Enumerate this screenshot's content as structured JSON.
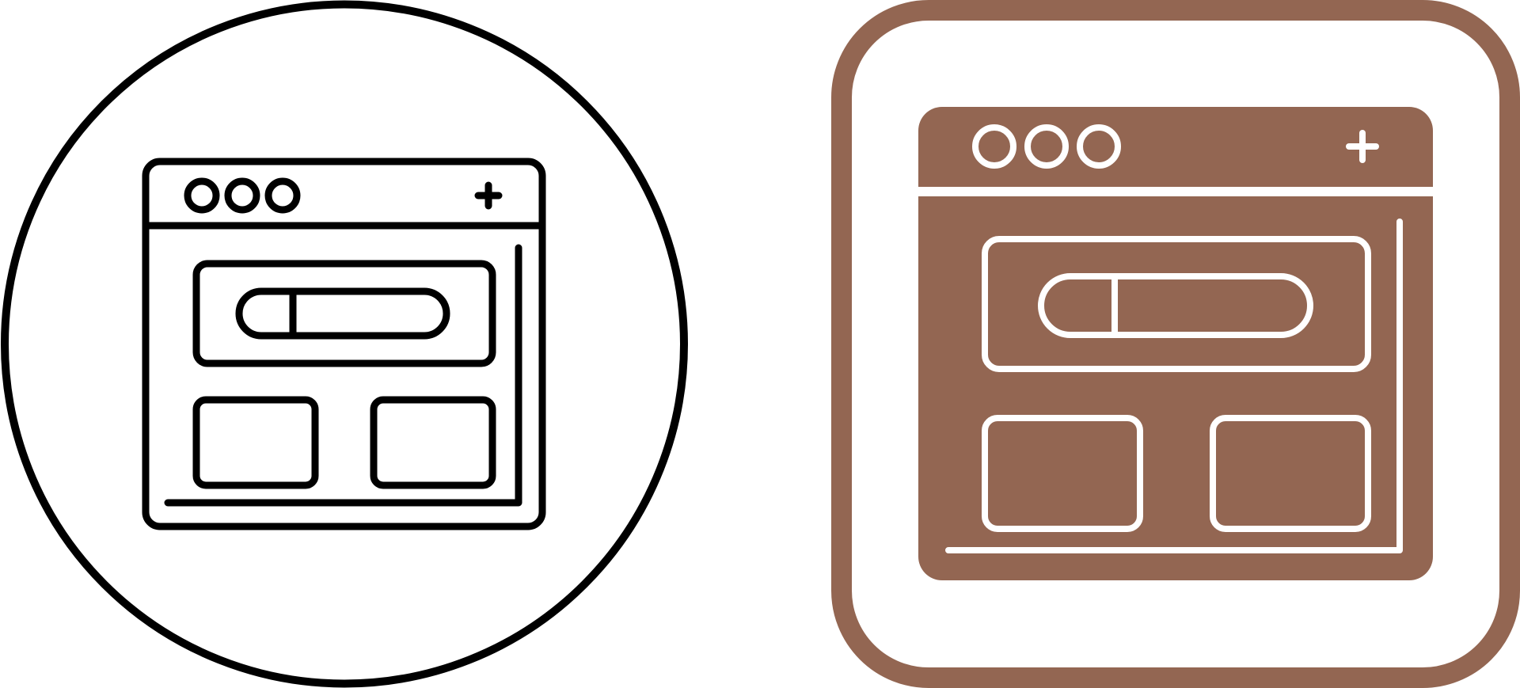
{
  "icons": [
    {
      "style": "outline",
      "frame_shape": "circle",
      "icon": "browser-window-icon",
      "stroke_color": "#000000",
      "fill_color": "#ffffff"
    },
    {
      "style": "filled",
      "frame_shape": "rounded-square",
      "icon": "browser-window-icon",
      "frame_color": "#936652",
      "fill_color": "#936652",
      "line_color": "#ffffff"
    }
  ]
}
